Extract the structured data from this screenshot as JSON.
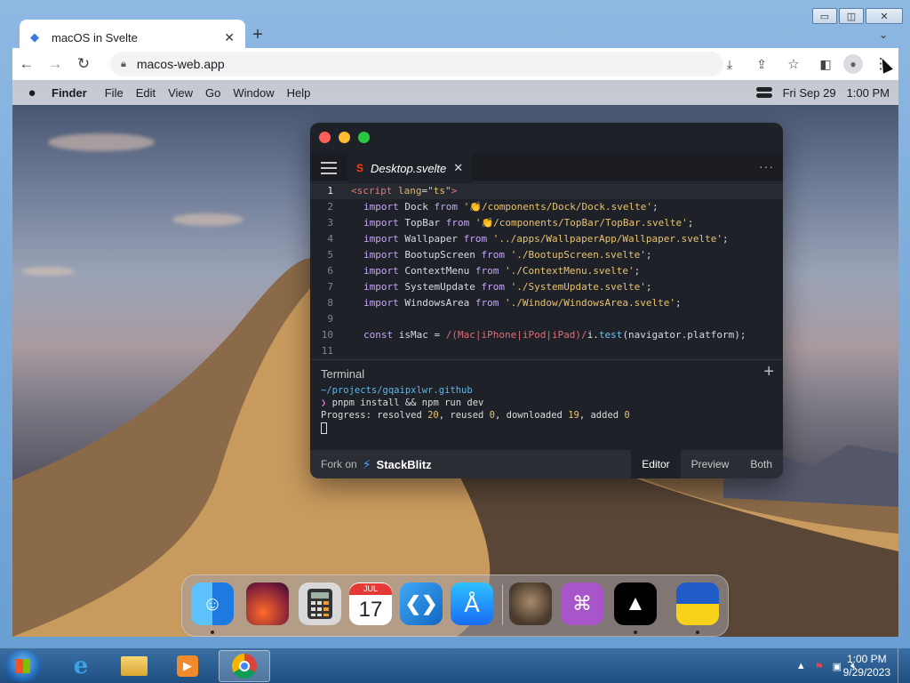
{
  "windows": {
    "caption_buttons": [
      "▭",
      "◫",
      "✕"
    ]
  },
  "browser": {
    "tab_title": "macOS in Svelte",
    "tab_close": "✕",
    "new_tab": "+",
    "tabs_menu": "⌄",
    "back": "←",
    "forward": "→",
    "reload": "↻",
    "url": "macos-web.app",
    "menu_dots": "⋮"
  },
  "mac": {
    "apple": "",
    "menus": [
      "Finder",
      "File",
      "Edit",
      "View",
      "Go",
      "Window",
      "Help"
    ],
    "date": "Fri Sep 29",
    "time": "1:00 PM"
  },
  "editor": {
    "file_name": "Desktop.svelte",
    "file_close": "✕",
    "more": "···",
    "line_numbers": [
      "1",
      "2",
      "3",
      "4",
      "5",
      "6",
      "7",
      "8",
      "9",
      "10",
      "11"
    ],
    "terminal_label": "Terminal",
    "terminal_plus": "+",
    "terminal": {
      "path": "~/projects/gqaipxlwr.github",
      "prompt": "❯",
      "command": "pnpm install && npm run dev",
      "progress_prefix": "Progress: resolved ",
      "resolved": "20",
      "reused_label": ", reused ",
      "reused": "0",
      "downloaded_label": ", downloaded ",
      "downloaded": "19",
      "added_label": ", added ",
      "added": "0"
    },
    "footer": {
      "fork_on": "Fork on",
      "brand": "StackBlitz",
      "tabs": [
        "Editor",
        "Preview",
        "Both"
      ]
    }
  },
  "dock": {
    "apps": [
      "finder-icon",
      "wallpapers-icon",
      "calculator-icon",
      "calendar-icon",
      "vscode-icon",
      "app-store-icon",
      "cat-photo-icon",
      "github-icon",
      "vercel-icon",
      "ukraine-flag-icon"
    ],
    "calendar_month": "JUL",
    "calendar_day": "17"
  },
  "taskbar": {
    "clock_time": "1:00 PM",
    "clock_date": "9/29/2023"
  },
  "colors": {
    "svelte": "#ff3e00",
    "traffic_red": "#ff5f57",
    "traffic_yellow": "#febc2e",
    "traffic_green": "#28c840"
  }
}
